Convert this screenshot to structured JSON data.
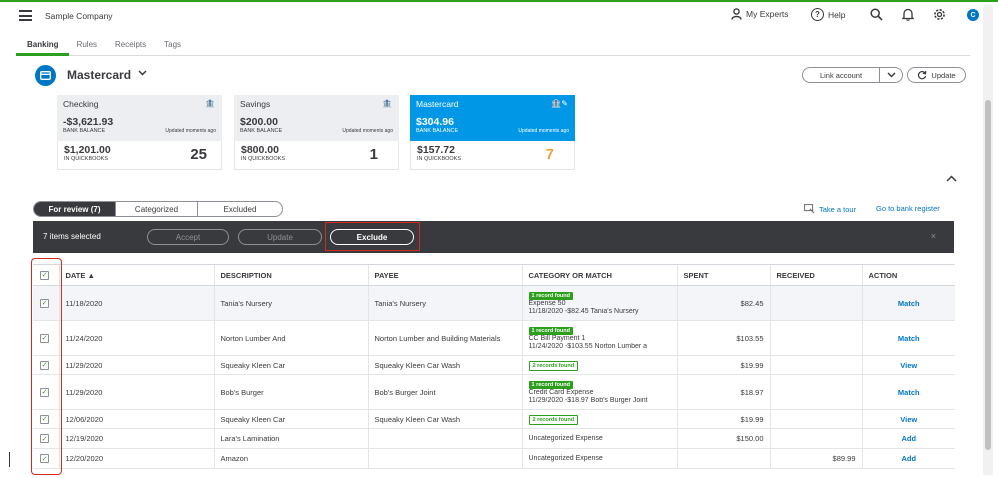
{
  "header": {
    "company": "Sample Company",
    "my_experts": "My Experts",
    "help": "Help",
    "avatar_letter": "C"
  },
  "nav_tabs": [
    "Banking",
    "Rules",
    "Receipts",
    "Tags"
  ],
  "account": {
    "name": "Mastercard",
    "link_account": "Link account",
    "update": "Update"
  },
  "cards": [
    {
      "name": "Checking",
      "bank_balance": "-$3,621.93",
      "bank_label": "BANK BALANCE",
      "updated": "Updated moments ago",
      "qb_balance": "$1,201.00",
      "qb_label": "IN QUICKBOOKS",
      "count": "25"
    },
    {
      "name": "Savings",
      "bank_balance": "$200.00",
      "bank_label": "BANK BALANCE",
      "updated": "Updated moments ago",
      "qb_balance": "$800.00",
      "qb_label": "IN QUICKBOOKS",
      "count": "1"
    },
    {
      "name": "Mastercard",
      "bank_balance": "$304.96",
      "bank_label": "BANK BALANCE",
      "updated": "Updated moments ago",
      "qb_balance": "$157.72",
      "qb_label": "IN QUICKBOOKS",
      "count": "7"
    }
  ],
  "review_tabs": [
    "For review (7)",
    "Categorized",
    "Excluded"
  ],
  "links": {
    "tour": "Take a tour",
    "register": "Go to bank register"
  },
  "bulk": {
    "selected": "7 items selected",
    "accept": "Accept",
    "update": "Update",
    "exclude": "Exclude",
    "close": "×"
  },
  "table": {
    "headers": [
      "DATE ▲",
      "DESCRIPTION",
      "PAYEE",
      "CATEGORY OR MATCH",
      "SPENT",
      "RECEIVED",
      "ACTION"
    ],
    "rows": [
      {
        "date": "11/18/2020",
        "description": "Tania's Nursery",
        "payee": "Tania's Nursery",
        "badge": "1 record found",
        "badge_style": "green",
        "cat1": "Expense 50",
        "cat2": "11/18/2020 -$82.45 Tania's Nursery",
        "spent": "$82.45",
        "received": "",
        "action": "Match"
      },
      {
        "date": "11/24/2020",
        "description": "Norton Lumber And",
        "payee": "Norton Lumber and Building Materials",
        "badge": "1 record found",
        "badge_style": "green",
        "cat1": "CC Bill Payment 1",
        "cat2": "11/24/2020 -$103.55 Norton Lumber a",
        "spent": "$103.55",
        "received": "",
        "action": "Match"
      },
      {
        "date": "11/29/2020",
        "description": "Squeaky Kleen Car",
        "payee": "Squeaky Kleen Car Wash",
        "badge": "2 records found",
        "badge_style": "outline",
        "cat1": "",
        "cat2": "",
        "spent": "$19.99",
        "received": "",
        "action": "View"
      },
      {
        "date": "11/29/2020",
        "description": "Bob's Burger",
        "payee": "Bob's Burger Joint",
        "badge": "1 record found",
        "badge_style": "green",
        "cat1": "Credit Card Expense",
        "cat2": "11/29/2020 -$18.97 Bob's Burger Joint",
        "spent": "$18.97",
        "received": "",
        "action": "Match"
      },
      {
        "date": "12/06/2020",
        "description": "Squeaky Kleen Car",
        "payee": "Squeaky Kleen Car Wash",
        "badge": "2 records found",
        "badge_style": "outline",
        "cat1": "",
        "cat2": "",
        "spent": "$19.99",
        "received": "",
        "action": "View"
      },
      {
        "date": "12/19/2020",
        "description": "Lara's Lamination",
        "payee": "",
        "badge": "",
        "badge_style": "",
        "cat1": "Uncategorized Expense",
        "cat2": "",
        "spent": "$150.00",
        "received": "",
        "action": "Add"
      },
      {
        "date": "12/20/2020",
        "description": "Amazon",
        "payee": "",
        "badge": "",
        "badge_style": "",
        "cat1": "Uncategorized Expense",
        "cat2": "",
        "spent": "",
        "received": "$89.99",
        "action": "Add"
      }
    ]
  },
  "colors": {
    "brand_green": "#2ca01c",
    "link_blue": "#0077c5",
    "count_orange": "#f2a03d",
    "highlight_red": "#d52b1e"
  }
}
